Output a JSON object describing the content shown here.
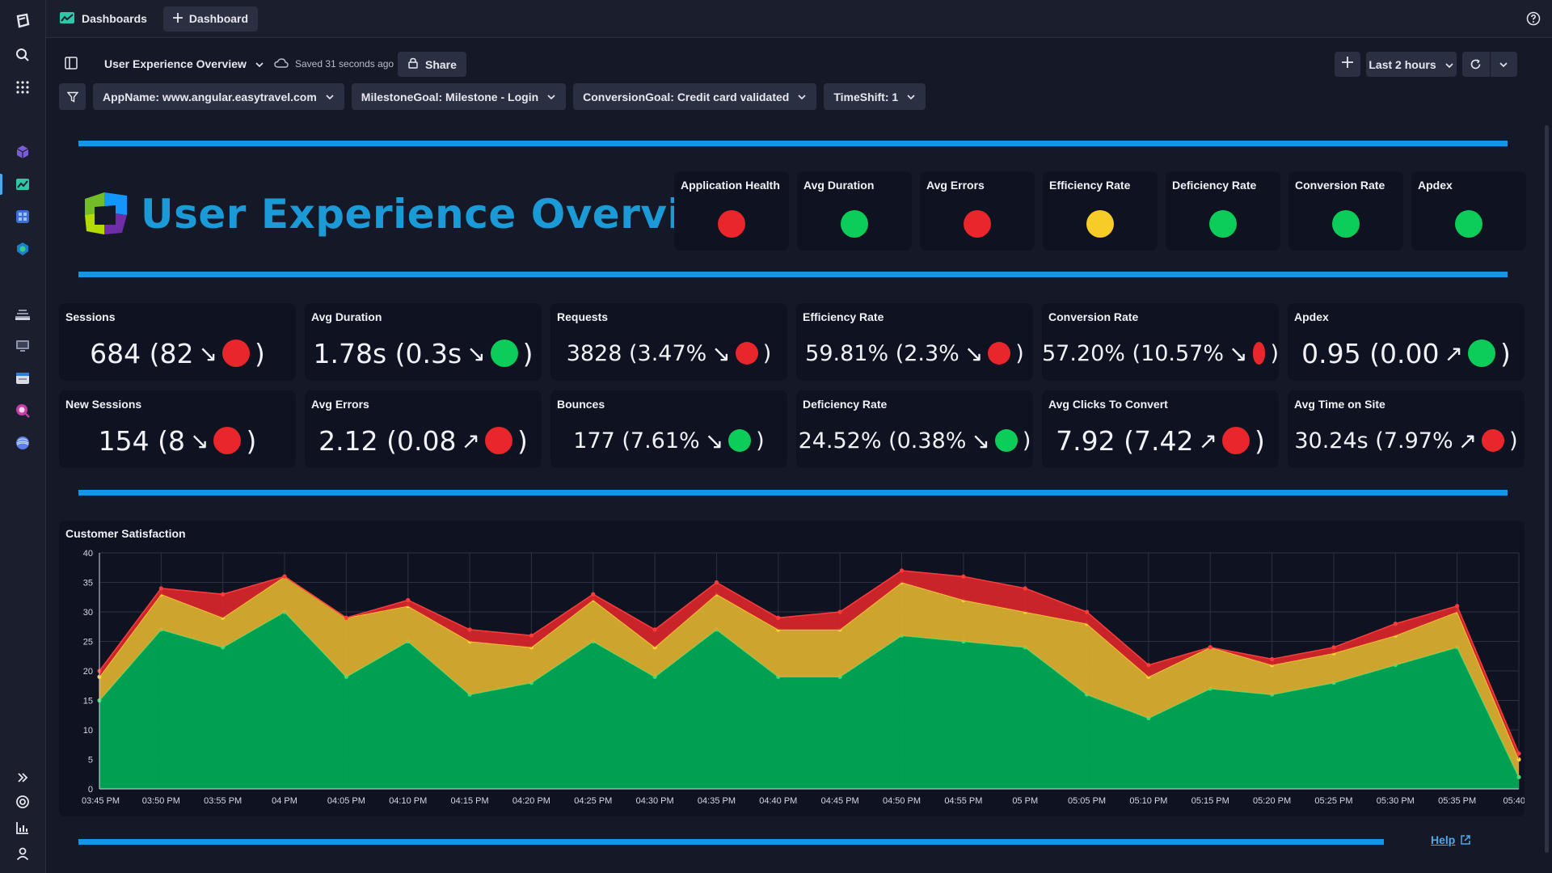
{
  "topbar": {
    "breadcrumb": "Dashboards",
    "new_tab_label": "Dashboard"
  },
  "dashboard": {
    "title": "User Experience Overview",
    "saved_status": "Saved 31 seconds ago",
    "share_label": "Share",
    "timeframe_label": "Last 2 hours"
  },
  "filters": [
    {
      "label": "AppName: www.angular.easytravel.com"
    },
    {
      "label": "MilestoneGoal: Milestone - Login"
    },
    {
      "label": "ConversionGoal: Credit card validated"
    },
    {
      "label": "TimeShift: 1"
    }
  ],
  "colors": {
    "red": "#e8262b",
    "green": "#0ccc5a",
    "yellow": "#f7cc29",
    "accent_blue": "#1496e6"
  },
  "header_title": "User Experience Overview",
  "health": [
    {
      "label": "Application Health",
      "status": "red"
    },
    {
      "label": "Avg Duration",
      "status": "green"
    },
    {
      "label": "Avg Errors",
      "status": "red"
    },
    {
      "label": "Efficiency Rate",
      "status": "yellow"
    },
    {
      "label": "Deficiency Rate",
      "status": "green"
    },
    {
      "label": "Conversion Rate",
      "status": "green"
    },
    {
      "label": "Apdex",
      "status": "green"
    }
  ],
  "kpis": [
    {
      "label": "Sessions",
      "value": "684 (82",
      "trend": "↘",
      "status": "red",
      "close": ")"
    },
    {
      "label": "Avg Duration",
      "value": "1.78s (0.3s",
      "trend": "↘",
      "status": "green",
      "close": ")"
    },
    {
      "label": "Requests",
      "value": "3828 (3.47%",
      "trend": "↘",
      "status": "red",
      "close": ")"
    },
    {
      "label": "Efficiency Rate",
      "value": "59.81% (2.3%",
      "trend": "↘",
      "status": "red",
      "close": ")"
    },
    {
      "label": "Conversion Rate",
      "value": "57.20% (10.57%",
      "trend": "↘",
      "status": "red",
      "close": ")"
    },
    {
      "label": "Apdex",
      "value": "0.95 (0.00",
      "trend": "↗",
      "status": "green",
      "close": ")"
    },
    {
      "label": "New Sessions",
      "value": "154 (8",
      "trend": "↘",
      "status": "red",
      "close": ")"
    },
    {
      "label": "Avg Errors",
      "value": "2.12 (0.08",
      "trend": "↗",
      "status": "red",
      "close": ")"
    },
    {
      "label": "Bounces",
      "value": "177 (7.61%",
      "trend": "↘",
      "status": "green",
      "close": ")"
    },
    {
      "label": "Deficiency Rate",
      "value": "24.52% (0.38%",
      "trend": "↘",
      "status": "green",
      "close": ")"
    },
    {
      "label": "Avg Clicks To Convert",
      "value": "7.92 (7.42",
      "trend": "↗",
      "status": "red",
      "close": ")"
    },
    {
      "label": "Avg Time on Site",
      "value": "30.24s (7.97%",
      "trend": "↗",
      "status": "red",
      "close": ")"
    }
  ],
  "help_label": "Help",
  "chart_data": {
    "type": "area",
    "title": "Customer Satisfaction",
    "stacked": true,
    "x": [
      "03:45 PM",
      "03:50 PM",
      "03:55 PM",
      "04 PM",
      "04:05 PM",
      "04:10 PM",
      "04:15 PM",
      "04:20 PM",
      "04:25 PM",
      "04:30 PM",
      "04:35 PM",
      "04:40 PM",
      "04:45 PM",
      "04:50 PM",
      "04:55 PM",
      "05 PM",
      "05:05 PM",
      "05:10 PM",
      "05:15 PM",
      "05:20 PM",
      "05:25 PM",
      "05:30 PM",
      "05:35 PM",
      "05:40"
    ],
    "ylim": [
      0,
      40
    ],
    "yticks": [
      0,
      5,
      10,
      15,
      20,
      25,
      30,
      35,
      40
    ],
    "grid": true,
    "series": [
      {
        "color": "#00a855",
        "values": [
          15,
          27,
          24,
          30,
          19,
          25,
          16,
          18,
          25,
          19,
          27,
          19,
          19,
          26,
          25,
          24,
          16,
          12,
          17,
          16,
          18,
          21,
          24,
          2
        ]
      },
      {
        "color": "#d8ad2e",
        "values": [
          4,
          6,
          5,
          6,
          10,
          6,
          9,
          6,
          7,
          5,
          6,
          8,
          8,
          9,
          7,
          6,
          12,
          7,
          7,
          5,
          5,
          5,
          6,
          3
        ]
      },
      {
        "color": "#d3262b",
        "values": [
          1,
          1,
          4,
          0,
          0,
          1,
          2,
          2,
          1,
          3,
          2,
          2,
          3,
          2,
          4,
          4,
          2,
          2,
          0,
          1,
          1,
          2,
          1,
          1
        ]
      }
    ]
  }
}
